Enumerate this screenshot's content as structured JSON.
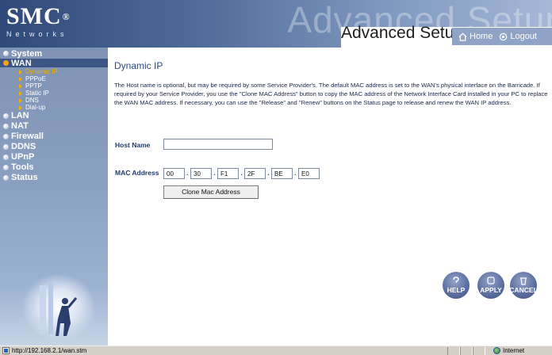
{
  "header": {
    "logo": "SMC",
    "logo_reg": "®",
    "logo_sub": "Networks",
    "watermark": "Advanced Setup",
    "title": "Advanced Setup",
    "home_label": "Home",
    "logout_label": "Logout"
  },
  "sidebar": {
    "items": [
      {
        "label": "System",
        "active": false
      },
      {
        "label": "WAN",
        "active": true,
        "children": [
          {
            "label": "Dynamic IP",
            "active": true
          },
          {
            "label": "PPPoE"
          },
          {
            "label": "PPTP"
          },
          {
            "label": "Static IP"
          },
          {
            "label": "DNS"
          },
          {
            "label": "Dial-up"
          }
        ]
      },
      {
        "label": "LAN"
      },
      {
        "label": "NAT"
      },
      {
        "label": "Firewall"
      },
      {
        "label": "DDNS"
      },
      {
        "label": "UPnP"
      },
      {
        "label": "Tools"
      },
      {
        "label": "Status"
      }
    ]
  },
  "main": {
    "title": "Dynamic IP",
    "description": "The Host name is optional, but may be required by some Service Provider's. The default MAC address is set to the WAN's physical interface on the Barricade. If required by your Service Provider, you use the \"Clone MAC Address\" button to copy the MAC address of the Network Interface Card installed in your PC to replace the WAN MAC address. If necessary, you can use the \"Release\" and \"Renew\" buttons on the Status page to release and renew the WAN IP address.",
    "host_name_label": "Host Name",
    "host_name_value": "",
    "mac_label": "MAC Address",
    "mac_octets": [
      "00",
      "30",
      "F1",
      "2F",
      "BE",
      "E0"
    ],
    "separator": ".",
    "clone_button": "Clone Mac Address",
    "help_label": "HELP",
    "apply_label": "APPLY",
    "cancel_label": "CANCEL"
  },
  "statusbar": {
    "url": "http://192.168.2.1/wan.stm",
    "zone": "Internet"
  },
  "colors": {
    "header_start": "#2f4a78",
    "sidebar": "#8aa0c0",
    "nav_active": "#3c5584",
    "sub_active": "#f0b000",
    "title": "#2a4a86"
  }
}
